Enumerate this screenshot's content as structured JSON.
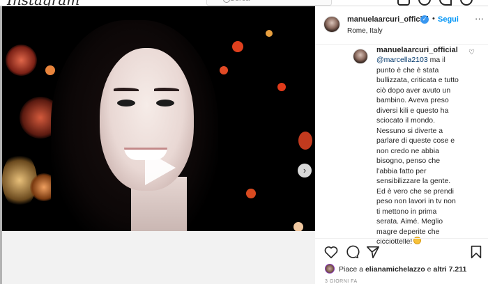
{
  "app": {
    "logo": "Instagram",
    "search_placeholder": "Cerca"
  },
  "post": {
    "username": "manuelaarcuri_official",
    "follow_label": "Segui",
    "location": "Rome, Italy",
    "more_icon": "ellipsis-icon"
  },
  "comment": {
    "username": "manuelaarcuri_official",
    "mention": "@marcella2103",
    "text": " ma il punto è che è stata bullizzata, criticata e tutto ciò dopo aver avuto un bambino. Aveva preso diversi kili e questo ha sciocato il mondo. Nessuno si diverte a parlare di queste cose e non credo ne abbia bisogno, penso che l'abbia fatto per sensibilizzare la gente. Ed è vero che se prendi peso non lavori in tv non ti mettono in prima serata. Aimé. Meglio magre deperite che cicciottelle!"
  },
  "likes": {
    "prefix": "Piace a ",
    "user": "elianamichelazzo",
    "middle": " e ",
    "count": "altri 7.211"
  },
  "date": "3 GIORNI FA",
  "colors": {
    "accent": "#0095f6",
    "verified": "#3897f0",
    "mention": "#00376b"
  }
}
